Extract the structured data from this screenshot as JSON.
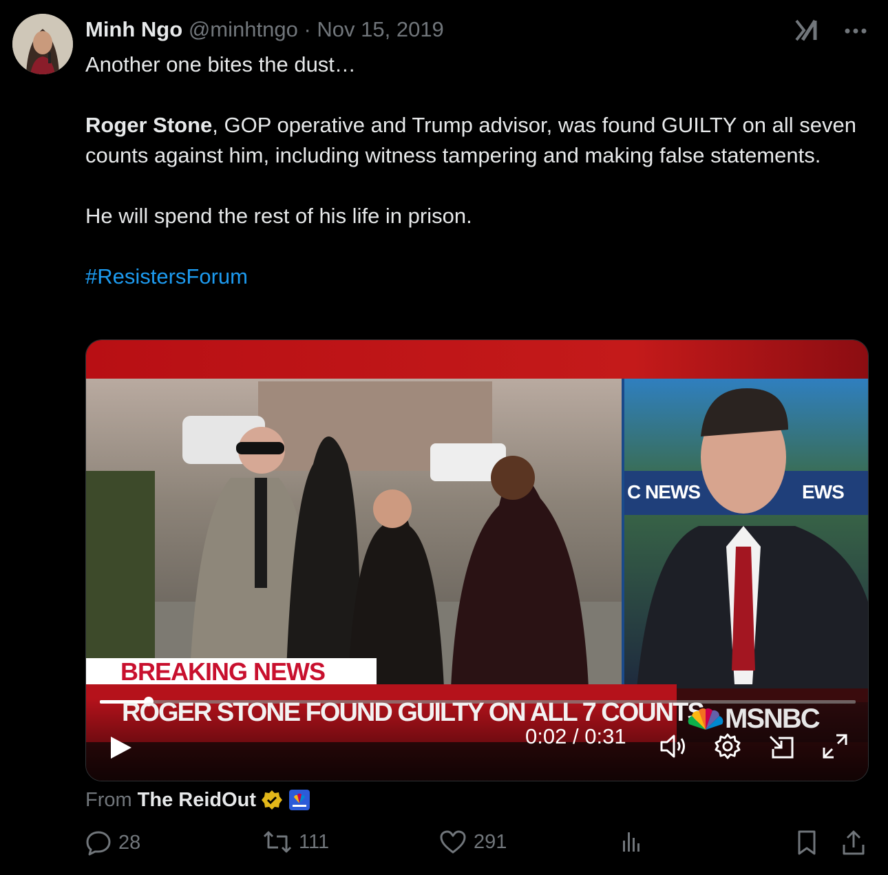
{
  "author": {
    "name": "Minh Ngo",
    "handle": "@minhtngo",
    "separator": "·",
    "date": "Nov 15, 2019"
  },
  "post": {
    "line1": "Another one bites the dust…",
    "bold_name": "Roger Stone",
    "para2_rest": ", GOP operative and Trump advisor, was found GUILTY on all seven counts against him, including witness tampering and making false statements.",
    "para3": "He will spend the rest of his life in prison.",
    "hashtag": "#ResistersForum"
  },
  "video": {
    "breaking_label": "BREAKING NEWS",
    "headline": "ROGER STONE FOUND GUILTY ON ALL 7 COUNTS",
    "network_logo": "MSNBC",
    "bg_sign_left": "C NEWS",
    "bg_sign_right": "EWS",
    "current_time": "0:02",
    "time_separator": "/",
    "duration": "0:31",
    "progress_fraction": 0.065
  },
  "source": {
    "from_label": "From",
    "brand": "The ReidOut"
  },
  "actions": {
    "replies": "28",
    "reposts": "111",
    "likes": "291"
  },
  "icons": [
    "grok-icon",
    "more-icon",
    "play-icon",
    "volume-icon",
    "settings-icon",
    "pip-icon",
    "fullscreen-icon",
    "reply-icon",
    "repost-icon",
    "like-icon",
    "views-icon",
    "bookmark-icon",
    "share-icon",
    "verified-badge-icon"
  ],
  "colors": {
    "accent": "#1d9bf0",
    "muted": "#71767b",
    "text": "#e7e9ea",
    "breaking_red": "#c8102e",
    "verified_gold": "#e2b719"
  }
}
